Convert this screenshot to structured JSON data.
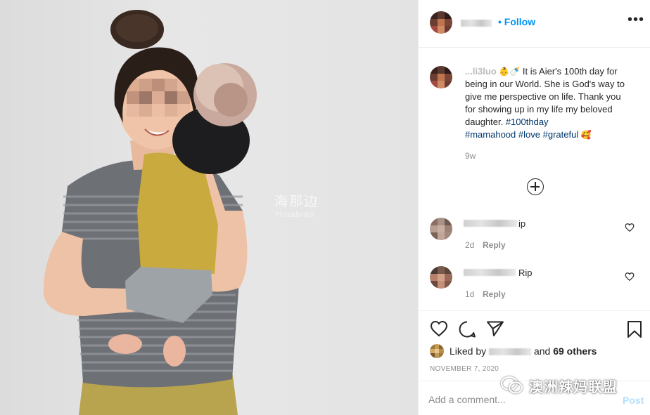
{
  "post": {
    "image_watermark": "海那边",
    "image_watermark_sub": "Hinabian"
  },
  "header": {
    "follow_label": "• Follow",
    "more_icon": "more-horizontal-icon"
  },
  "caption": {
    "username": "...li3luo",
    "text": " It is Aier's 100th day for being in our World. She is God's way to give me perspective on life. Thank you for showing up in my life my beloved daughter. ",
    "hashtags": [
      "#100thday",
      "#mamahood",
      "#love",
      "#grateful"
    ],
    "emojis_lead": "👶🍼",
    "emoji_tail": "🥰",
    "time": "9w"
  },
  "load_more_icon": "plus-circle-icon",
  "comments": [
    {
      "text": "ip",
      "time": "2d",
      "reply_label": "Reply"
    },
    {
      "text": "Rip",
      "time": "1d",
      "reply_label": "Reply"
    }
  ],
  "actions": {
    "like_icon": "heart-icon",
    "comment_icon": "comment-icon",
    "share_icon": "share-icon",
    "save_icon": "bookmark-icon",
    "liked_prefix": "Liked by",
    "liked_suffix": "and",
    "liked_count": "69 others",
    "date": "NOVEMBER 7, 2020"
  },
  "add_comment": {
    "placeholder": "Add a comment...",
    "post_label": "Post"
  },
  "overlay": {
    "wechat_text": "澳洲辣妈联盟",
    "wechat_icon": "wechat-icon"
  },
  "colors": {
    "link": "#0095f6",
    "hashtag": "#00376b",
    "muted": "#8e8e8e",
    "post_disabled": "#b2dffc"
  }
}
